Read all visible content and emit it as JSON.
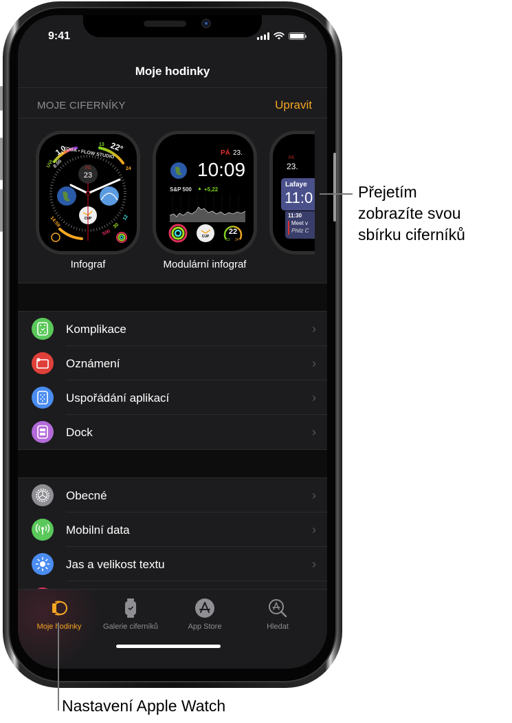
{
  "status_bar": {
    "time": "9:41"
  },
  "nav": {
    "title": "Moje hodinky"
  },
  "faces": {
    "section_title": "MOJE CIFERNÍKY",
    "edit_label": "Upravit",
    "items": [
      {
        "name": "Infograf",
        "complications": {
          "uv_value": "1,0",
          "uv_label": "UVI",
          "event_time": "8:00",
          "event_name": "YOGA • FLOW STUDIO",
          "temp_low": "13",
          "temp_current": "22°",
          "temp_high": "24",
          "day": "PÁ",
          "date": "23",
          "cup_label": "CUP",
          "timer": "14:59",
          "activity_move": "500",
          "activity_exercise": "30",
          "activity_stand": "12"
        }
      },
      {
        "name": "Modulární infograf",
        "complications": {
          "day": "PÁ",
          "date": "23.",
          "time": "10:09",
          "stock_name": "S&P 500",
          "stock_change": "+5,22",
          "cup_label": "CUP",
          "temp": "22",
          "temp_low": "13",
          "temp_high": "24"
        }
      },
      {
        "name": "",
        "complications": {
          "day": "PÁ",
          "date": "23.",
          "location": "Lafaye",
          "time": "11:0",
          "event_time": "11:30",
          "event_title": "Meet v",
          "event_place": "Philz C"
        }
      }
    ]
  },
  "settings_group_1": [
    {
      "label": "Komplikace",
      "icon": "complications-icon",
      "color": "#5ac85a"
    },
    {
      "label": "Oznámení",
      "icon": "notifications-icon",
      "color": "#e0403a"
    },
    {
      "label": "Uspořádání aplikací",
      "icon": "app-layout-icon",
      "color": "#4a8cf0"
    },
    {
      "label": "Dock",
      "icon": "dock-icon",
      "color": "#b36ad8"
    }
  ],
  "settings_group_2": [
    {
      "label": "Obecné",
      "icon": "gear-icon",
      "color": "#8e8e93"
    },
    {
      "label": "Mobilní data",
      "icon": "cellular-icon",
      "color": "#5ac85a"
    },
    {
      "label": "Jas a velikost textu",
      "icon": "brightness-icon",
      "color": "#4a8cf0"
    }
  ],
  "tabs": [
    {
      "label": "Moje hodinky",
      "icon": "my-watch-icon",
      "active": true
    },
    {
      "label": "Galerie ciferníků",
      "icon": "face-gallery-icon",
      "active": false
    },
    {
      "label": "App Store",
      "icon": "app-store-icon",
      "active": false
    },
    {
      "label": "Hledat",
      "icon": "search-icon",
      "active": false
    }
  ],
  "callouts": {
    "swipe": [
      "Přejetím",
      "zobrazíte svou",
      "sbírku ciferníků"
    ],
    "settings": "Nastavení Apple Watch"
  },
  "colors": {
    "accent": "#f5a623",
    "background": "#1c1c1e",
    "secondary_text": "#8e8e93"
  }
}
